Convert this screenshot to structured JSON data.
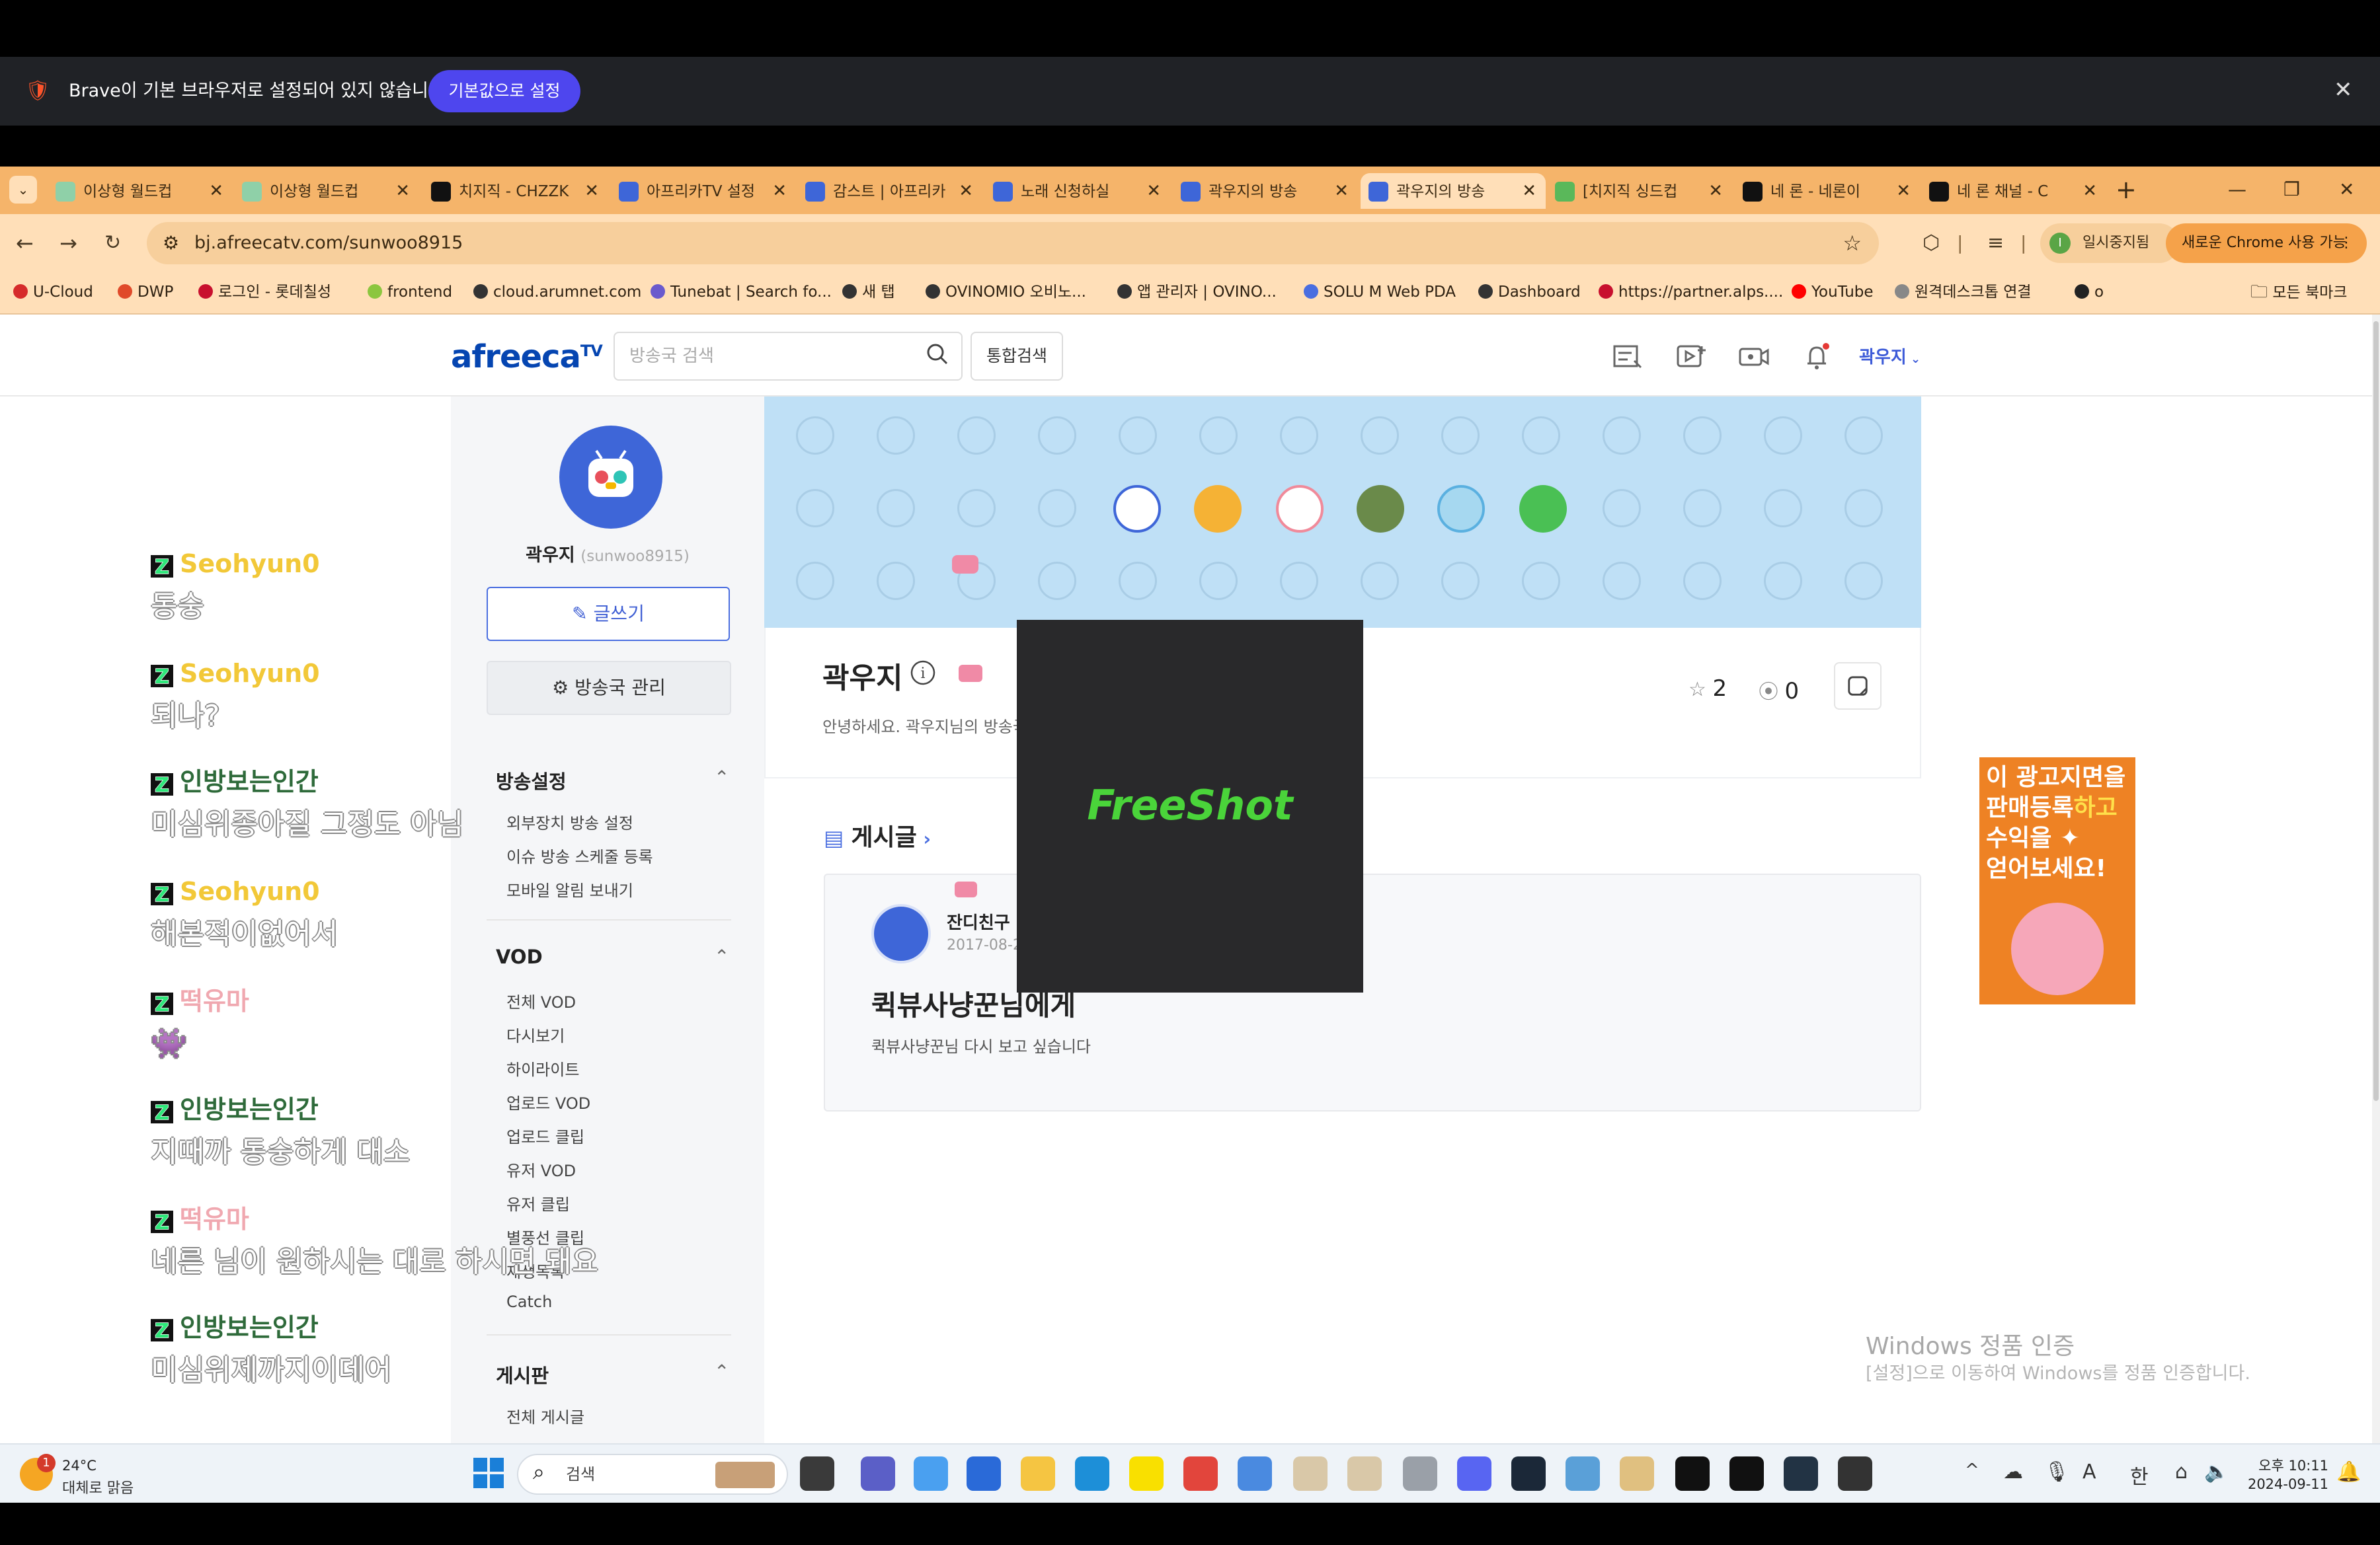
{
  "colors": {
    "brand_blue": "#0545b1",
    "tab_strip": "#f5b46a",
    "toolbar": "#ffdfb8",
    "banner_bg": "#bfe0f6",
    "notice_button": "#4e46ee"
  },
  "notice": {
    "message": "Brave이 기본 브라우저로 설정되어 있지 않습니다",
    "button": "기본값으로 설정",
    "close": "✕"
  },
  "tabs": [
    {
      "title": "이상형 월드컵",
      "icon_color": "#8fd0a8",
      "icon": "tab-favicon-icon"
    },
    {
      "title": "이상형 월드컵",
      "icon_color": "#8fd0a8",
      "icon": "tab-favicon-icon"
    },
    {
      "title": "치지직 - CHZZK",
      "icon_color": "#111111",
      "icon": "chzzk-icon"
    },
    {
      "title": "아프리카TV 설정",
      "icon_color": "#3e66d8",
      "icon": "afreeca-icon"
    },
    {
      "title": "감스트 | 아프리카",
      "icon_color": "#3e66d8",
      "icon": "afreeca-icon"
    },
    {
      "title": "노래 신청하실",
      "icon_color": "#3e66d8",
      "icon": "afreeca-icon"
    },
    {
      "title": "곽우지의 방송",
      "icon_color": "#3e66d8",
      "icon": "afreeca-icon"
    },
    {
      "title": "곽우지의 방송",
      "icon_color": "#3e66d8",
      "icon": "afreeca-icon"
    },
    {
      "title": "[치지직 싱드컵",
      "icon_color": "#5ab85a",
      "icon": "tab-favicon-icon"
    },
    {
      "title": "네 론 - 네론이",
      "icon_color": "#111111",
      "icon": "chzzk-icon"
    },
    {
      "title": "네 론 채널 - C",
      "icon_color": "#111111",
      "icon": "chzzk-icon"
    }
  ],
  "toolbar": {
    "url": "bj.afreecatv.com/sunwoo8915",
    "pause_chip": "일시중지됨",
    "pause_initial": "I",
    "new_chrome": "새로운 Chrome 사용 가능"
  },
  "bookmarks": [
    {
      "label": "U-Cloud",
      "color": "#d62b2b"
    },
    {
      "label": "DWP",
      "color": "#e04a2a"
    },
    {
      "label": "로그인 - 롯데칠성",
      "color": "#c8102e"
    },
    {
      "label": "frontend",
      "color": "#8cc63f"
    },
    {
      "label": "cloud.arumnet.com",
      "color": "#333333"
    },
    {
      "label": "Tunebat | Search fo...",
      "color": "#6a5acd"
    },
    {
      "label": "새 탭",
      "color": "#333333"
    },
    {
      "label": "OVINOMIO 오비노...",
      "color": "#333333"
    },
    {
      "label": "앱 관리자 | OVINO...",
      "color": "#333333"
    },
    {
      "label": "SOLU M Web PDA",
      "color": "#4a6ee0"
    },
    {
      "label": "Dashboard",
      "color": "#333333"
    },
    {
      "label": "https://partner.alps....",
      "color": "#c8102e"
    },
    {
      "label": "YouTube",
      "color": "#ff0000"
    },
    {
      "label": "원격데스크톱 연결",
      "color": "#888888"
    },
    {
      "label": "o",
      "color": "#222222"
    }
  ],
  "bookmarks_all": "모든 북마크",
  "site": {
    "logo": "afreeca",
    "logo_sup": "TV",
    "search_placeholder": "방송국 검색",
    "all_search": "통합검색",
    "username": "곽우지"
  },
  "chat": [
    {
      "name": "Seohyun0",
      "name_color": "#f2c838",
      "message": "동숭"
    },
    {
      "name": "Seohyun0",
      "name_color": "#f2c838",
      "message": "되나?"
    },
    {
      "name": "인방보는인간",
      "name_color": "#2e6a3a",
      "message": "미심위종아질 그정도 아님"
    },
    {
      "name": "Seohyun0",
      "name_color": "#f2c838",
      "message": "해본적이없어서"
    },
    {
      "name": "떡유마",
      "name_color": "#f0a8b0",
      "message": "👾"
    },
    {
      "name": "인방보는인간",
      "name_color": "#2e6a3a",
      "message": "지때까 동숭하게 대소"
    },
    {
      "name": "떡유마",
      "name_color": "#f0a8b0",
      "message": "네른 님이 원하시는 대로 하시면 돼요"
    },
    {
      "name": "인방보는인간",
      "name_color": "#2e6a3a",
      "message": "미심위제까지이데어"
    }
  ],
  "sidebar": {
    "name": "곽우지",
    "id": "(sunwoo8915)",
    "write_button": "글쓰기",
    "manage_button": "방송국 관리",
    "sections": [
      {
        "title": "방송설정",
        "items": [
          "외부장치 방송 설정",
          "이슈 방송 스케줄 등록",
          "모바일 알림 보내기"
        ]
      },
      {
        "title": "VOD",
        "items": [
          "전체 VOD",
          "다시보기",
          "하이라이트",
          "업로드 VOD",
          "업로드 클립",
          "유저 VOD",
          "유저 클립",
          "별풍선 클립",
          "재생목록",
          "Catch"
        ]
      },
      {
        "title": "게시판",
        "items": [
          "전체 게시글"
        ]
      }
    ]
  },
  "profile": {
    "name": "곽우지",
    "description": "안녕하세요. 곽우지님의 방송국입니다.",
    "favorites": "2",
    "subscribers": "0"
  },
  "posts": {
    "header": "게시글",
    "items": [
      {
        "author": "잔디친구",
        "date": "2017-08-27",
        "title": "퀵뷰사냥꾼님에게",
        "body": "퀵뷰사냥꾼님 다시 보고 싶습니다"
      }
    ]
  },
  "overlay": {
    "logo": "FreeShot"
  },
  "ad": {
    "line1": "이 광고지면을",
    "line2a": "판매등록",
    "line2b": "하고",
    "line3": "수익을 ✦",
    "line4": "얻어보세요!"
  },
  "windows": {
    "watermark_title": "Windows 정품 인증",
    "watermark_sub": "[설정]으로 이동하여 Windows를 정품 인증합니다."
  },
  "taskbar": {
    "weather_temp": "24°C",
    "weather_desc": "대체로 맑음",
    "weather_badge": "1",
    "search": "검색",
    "ime_a": "A",
    "ime_han": "한",
    "time": "오후 10:11",
    "date": "2024-09-11"
  }
}
